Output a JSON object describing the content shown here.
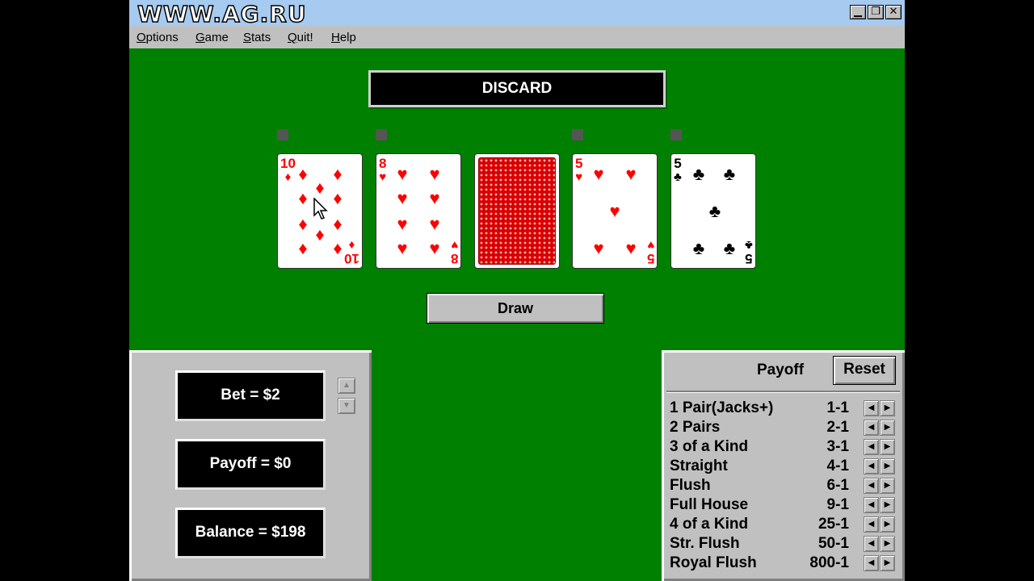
{
  "window": {
    "logo": "WWW.AG.RU",
    "buttons": {
      "minimize": "▁",
      "restore": "❐",
      "close": "✕"
    }
  },
  "menu": [
    "Options",
    "Game",
    "Stats",
    "Quit!",
    "Help"
  ],
  "banner": "DISCARD",
  "hand": [
    {
      "rank": "10",
      "suit": "♦",
      "color": "red",
      "held": true
    },
    {
      "rank": "8",
      "suit": "♥",
      "color": "red",
      "held": true
    },
    {
      "rank": "",
      "suit": "",
      "color": "back",
      "held": false
    },
    {
      "rank": "5",
      "suit": "♥",
      "color": "red",
      "held": true
    },
    {
      "rank": "5",
      "suit": "♣",
      "color": "black",
      "held": true
    }
  ],
  "draw_label": "Draw",
  "bet": {
    "label": "Bet = $2"
  },
  "payoff": {
    "label": "Payoff = $0"
  },
  "balance": {
    "label": "Balance = $198"
  },
  "payoff_table": {
    "title": "Payoff",
    "reset_label": "Reset",
    "rows": [
      {
        "hand": "1 Pair(Jacks+)",
        "odds": "1-1"
      },
      {
        "hand": "2 Pairs",
        "odds": "2-1"
      },
      {
        "hand": "3 of a Kind",
        "odds": "3-1"
      },
      {
        "hand": "Straight",
        "odds": "4-1"
      },
      {
        "hand": "Flush",
        "odds": "6-1"
      },
      {
        "hand": "Full House",
        "odds": "9-1"
      },
      {
        "hand": "4 of a Kind",
        "odds": "25-1"
      },
      {
        "hand": "Str. Flush",
        "odds": "50-1"
      },
      {
        "hand": "Royal Flush",
        "odds": "800-1"
      }
    ]
  },
  "colors": {
    "felt": "#008000",
    "red_suit": "#ff0000",
    "panel": "#c0c0c0"
  }
}
